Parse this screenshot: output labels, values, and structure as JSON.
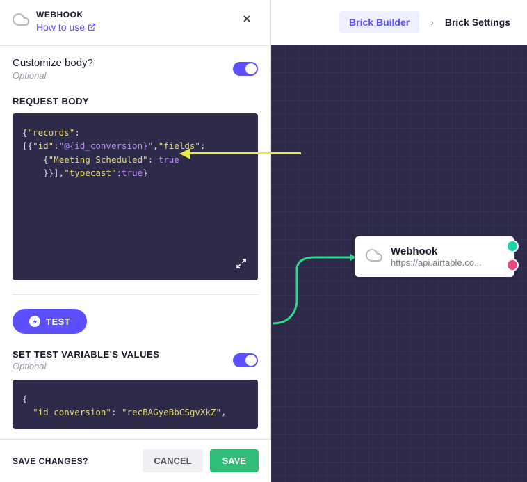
{
  "header": {
    "title": "WEBHOOK",
    "how_link": "How to use"
  },
  "breadcrumbs": {
    "active": "Brick Builder",
    "inactive": "Brick Settings"
  },
  "fields": {
    "customize_body_label": "Customize body?",
    "optional": "Optional",
    "request_body_heading": "REQUEST BODY",
    "set_test_heading": "SET TEST VARIABLE'S VALUES"
  },
  "code": {
    "line1_key1": "\"records\"",
    "line1_key2": "\"id\"",
    "line1_val": "\"@{id_conversion}\"",
    "line1_key3": "\"fields\"",
    "line2_key": "\"Meeting Scheduled\"",
    "line2_val": "true",
    "line3_key": "\"typecast\"",
    "line3_val": "true",
    "test_key": "\"id_conversion\"",
    "test_val": "\"recBAGyeBbCSgvXkZ\""
  },
  "buttons": {
    "test": "TEST",
    "save_prompt": "SAVE CHANGES?",
    "cancel": "CANCEL",
    "save": "SAVE"
  },
  "node": {
    "title": "Webhook",
    "subtitle": "https://api.airtable.co..."
  }
}
